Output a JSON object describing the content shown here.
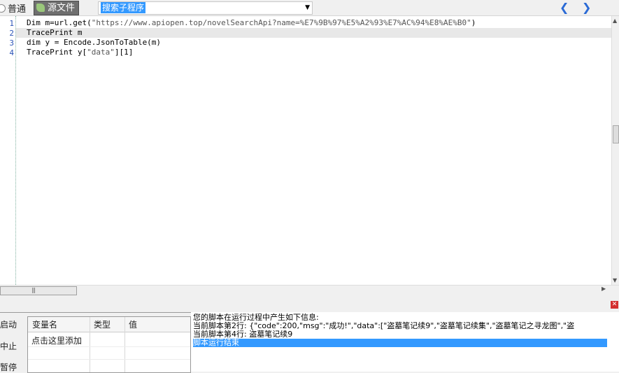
{
  "toolbar": {
    "tab_normal": "普通",
    "tab_source": "源文件",
    "combo_value": "搜索子程序",
    "nav_back": "❮",
    "nav_forward": "❯"
  },
  "editor": {
    "line_numbers": [
      "1",
      "2",
      "3",
      "4"
    ],
    "lines": [
      {
        "code": "Dim m=url.get(",
        "str": "\"https://www.apiopen.top/novelSearchApi?name=%E7%9B%97%E5%A2%93%E7%AC%94%E8%AE%B0\"",
        "tail": ")"
      },
      {
        "code": "TracePrint m",
        "str": "",
        "tail": ""
      },
      {
        "code": "dim y = Encode.JsonToTable(m)",
        "str": "",
        "tail": ""
      },
      {
        "code": "TracePrint y[",
        "str": "\"data\"",
        "tail": "][1]"
      }
    ]
  },
  "side_buttons": {
    "start": "启动",
    "stop": "中止",
    "pause": "暂停"
  },
  "variables": {
    "headers": [
      "变量名",
      "类型",
      "值"
    ],
    "add_row": "点击这里添加"
  },
  "output": {
    "lines": [
      "您的脚本在运行过程中产生如下信息:",
      "当前脚本第2行: {\"code\":200,\"msg\":\"成功!\",\"data\":[\"盗墓笔记续9\",\"盗墓笔记续集\",\"盗墓笔记之寻龙图\",\"盗",
      "当前脚本第4行: 盗墓笔记续9",
      "脚本运行结束"
    ]
  },
  "colors": {
    "selection": "#3399ff",
    "line_number": "#2b55b8",
    "nav_arrow": "#2a6ad5"
  }
}
